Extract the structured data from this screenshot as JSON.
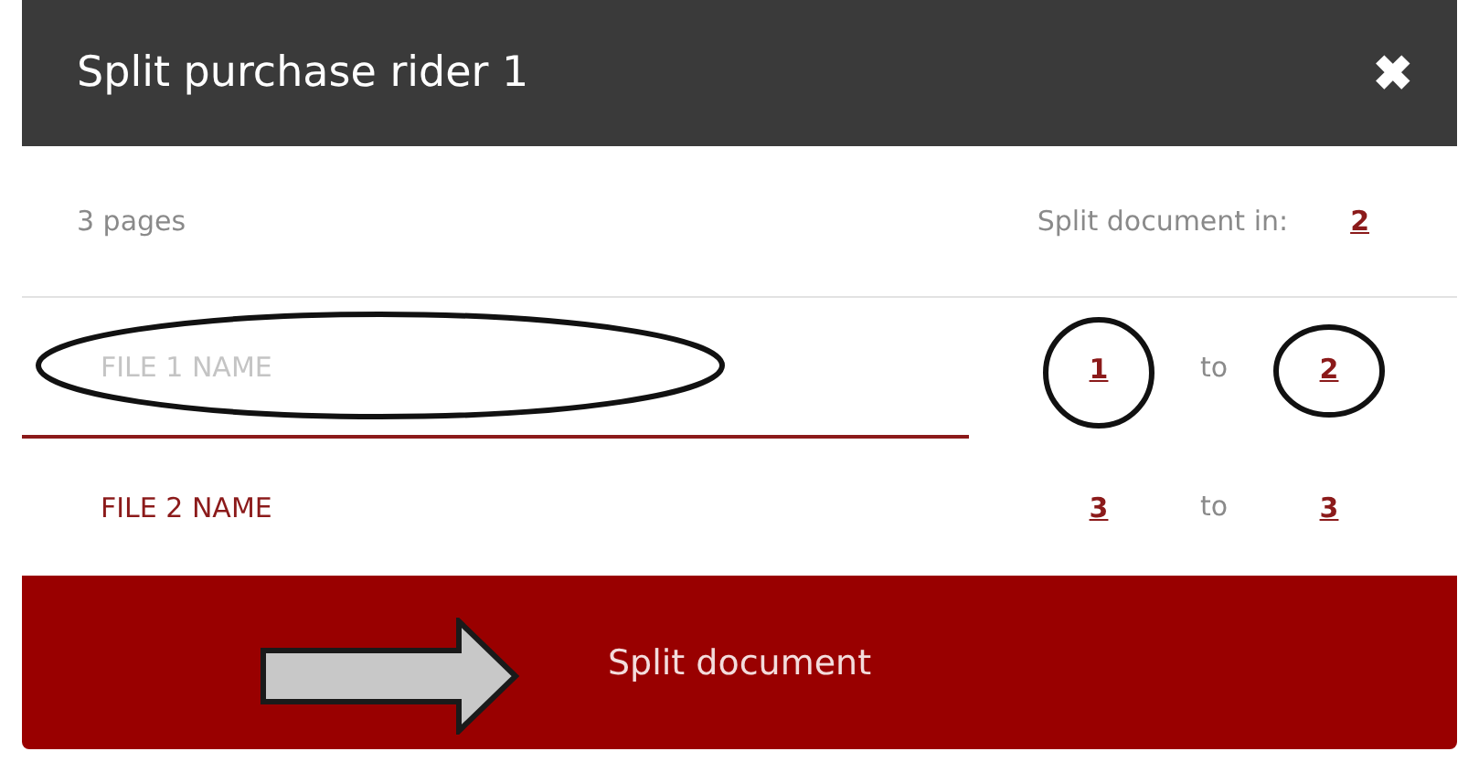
{
  "dialog": {
    "title": "Split purchase rider 1",
    "close": "✖"
  },
  "summary": {
    "pages": "3 pages",
    "split_label": "Split document in:",
    "split_count": "2"
  },
  "files": [
    {
      "placeholder": "FILE 1 NAME",
      "focused": true,
      "annotated": true,
      "from": "1",
      "to_word": "to",
      "to": "2"
    },
    {
      "value": "FILE 2 NAME",
      "focused": false,
      "annotated": false,
      "from": "3",
      "to_word": "to",
      "to": "3"
    }
  ],
  "button": {
    "label": "Split document",
    "annotated": true
  }
}
